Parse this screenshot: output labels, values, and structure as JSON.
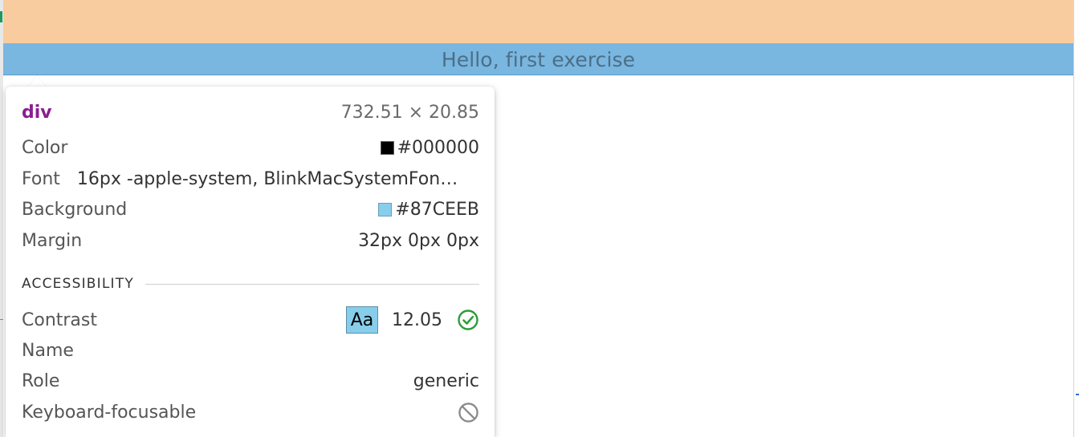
{
  "page": {
    "highlight_text": "Hello, first exercise"
  },
  "tooltip": {
    "tag": "div",
    "dimensions": "732.51 × 20.85",
    "color": {
      "label": "Color",
      "value": "#000000"
    },
    "font": {
      "label": "Font",
      "value": "16px -apple-system, BlinkMacSystemFon…"
    },
    "background": {
      "label": "Background",
      "value": "#87CEEB"
    },
    "margin": {
      "label": "Margin",
      "value": "32px 0px 0px"
    },
    "accessibility": {
      "section_title": "ACCESSIBILITY",
      "contrast": {
        "label": "Contrast",
        "sample": "Aa",
        "ratio": "12.05",
        "status_icon": "check-circle-icon"
      },
      "name": {
        "label": "Name",
        "value": ""
      },
      "role": {
        "label": "Role",
        "value": "generic"
      },
      "keyboard_focusable": {
        "label": "Keyboard-focusable",
        "status_icon": "blocked-icon"
      }
    }
  },
  "colors": {
    "header_band": "#f8cc9f",
    "highlight_band": "#79b6e0",
    "tag_name": "#8a1f92",
    "color_swatch": "#000000",
    "background_swatch": "#87ceeb",
    "check_green": "#2e9c3a",
    "blocked_gray": "#8a8a8a"
  }
}
